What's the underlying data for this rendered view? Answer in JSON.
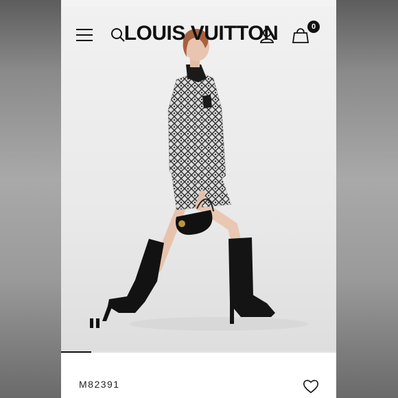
{
  "header": {
    "brand": "LOUIS VUITTON",
    "menu_icon": "menu-icon",
    "search_icon": "search-icon",
    "account_icon": "account-icon",
    "bag_icon": "shopping-bag-icon",
    "bag_count": "0"
  },
  "media": {
    "pause_icon": "pause-icon",
    "progress": 0.11
  },
  "product": {
    "sku": "M82391",
    "wishlist_icon": "heart-outline-icon"
  },
  "colors": {
    "text": "#111111",
    "background": "#ffffff",
    "hero_background": "#eaeaea"
  }
}
